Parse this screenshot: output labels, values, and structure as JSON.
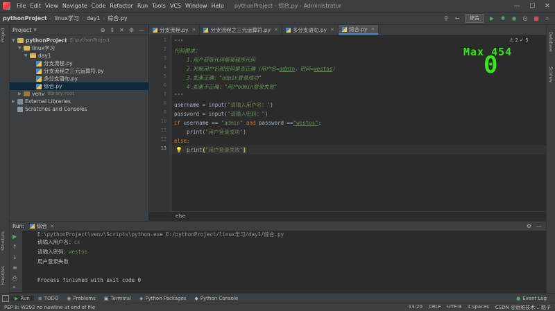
{
  "menu": {
    "items": [
      "File",
      "Edit",
      "View",
      "Navigate",
      "Code",
      "Refactor",
      "Run",
      "Tools",
      "VCS",
      "Window",
      "Help"
    ],
    "window_title": "pythonProject - 综合.py - Administrator"
  },
  "navbar": {
    "crumbs": [
      "pythonProject",
      "linux学习",
      "day1",
      "综合.py"
    ],
    "run_config": "综合"
  },
  "project_panel": {
    "title": "Project",
    "rows": [
      {
        "label": "pythonProject",
        "hint": "E:\\pythonProject",
        "kind": "folder"
      },
      {
        "label": "linux学习",
        "hint": "",
        "kind": "folder"
      },
      {
        "label": "day1",
        "hint": "",
        "kind": "folder"
      },
      {
        "label": "分支流程.py",
        "hint": "",
        "kind": "py"
      },
      {
        "label": "分支流程之三元运算符.py",
        "hint": "",
        "kind": "py"
      },
      {
        "label": "多分支语句.py",
        "hint": "",
        "kind": "py"
      },
      {
        "label": "综合.py",
        "hint": "",
        "kind": "py"
      },
      {
        "label": "venv",
        "hint": "library root",
        "kind": "folder"
      },
      {
        "label": "External Libraries",
        "hint": "",
        "kind": "lib"
      },
      {
        "label": "Scratches and Consoles",
        "hint": "",
        "kind": "lib"
      }
    ]
  },
  "editor": {
    "tabs": [
      "分支流程.py",
      "分支流程之三元运算符.py",
      "多分支语句.py",
      "综合.py"
    ],
    "line_numbers": [
      "1",
      "2",
      "3",
      "4",
      "5",
      "6",
      "7",
      "8",
      "9",
      "10",
      "11",
      "12",
      "13"
    ],
    "code": {
      "l1": "\"\"\"",
      "l2": "代码需求：",
      "l3a": "    1.用户获取代码框架程序代码",
      "l4a": "    2.判断用户名和密码是否正确（用户名=",
      "l4b": "admin",
      "l4c": "，密码=",
      "l4d": "westos",
      "l4e": "）",
      "l5": "    3.如果正确：\"odmin登录成功\"",
      "l6": "    4.如果不正确：\"用户odmin登录失败\"",
      "l7": "\"\"\"",
      "l8a": "username = input(",
      "l8b": "\"请输入用户名：\"",
      "l8c": ")",
      "l9a": "password = input(",
      "l9b": "\"请输入密码：\"",
      "l9c": ")",
      "l10a": "if",
      "l10b": " username == ",
      "l10c": "\"admin\"",
      "l10d": " and",
      "l10e": " password ==",
      "l10f": "\"westos\"",
      "l10g": ":",
      "l11a": "    print(",
      "l11b": "\"用户登录成功\"",
      "l11c": ")",
      "l12": "else:",
      "l13a": "    print",
      "l13b": "(",
      "l13c": "\"用户登录失败\"",
      "l13d": ")"
    },
    "warning_counts": "⚠ 2  ✓ 5",
    "bottom_crumb": "else",
    "overlay_label": "Max 454",
    "overlay_value": "0"
  },
  "run_panel": {
    "label": "Run:",
    "tab": "综合",
    "lines": {
      "cmd": "E:\\pythonProject\\venv\\Scripts\\python.exe E:/pythonProject/linux学习/day1/综合.py",
      "q1": "请输入用户名：",
      "a1": "cx",
      "q2": "请输入密码：",
      "a2": "westos",
      "r": "用户登录失败",
      "exit": "Process finished with exit code 0"
    }
  },
  "tool_windows": [
    "Run",
    "TODO",
    "Problems",
    "Terminal",
    "Python Packages",
    "Python Console"
  ],
  "event_log": "Event Log",
  "status": {
    "message": "PEP 8: W292 no newline at end of file",
    "position": "13:20",
    "line_sep": "CRLF",
    "encoding": "UTF-8",
    "indent": "4 spaces",
    "watermark": "CSDN @运维技术... 路子"
  },
  "side_labels": {
    "left": [
      "Project",
      "Structure",
      "Favorites"
    ],
    "right": [
      "Database",
      "SciView"
    ]
  }
}
